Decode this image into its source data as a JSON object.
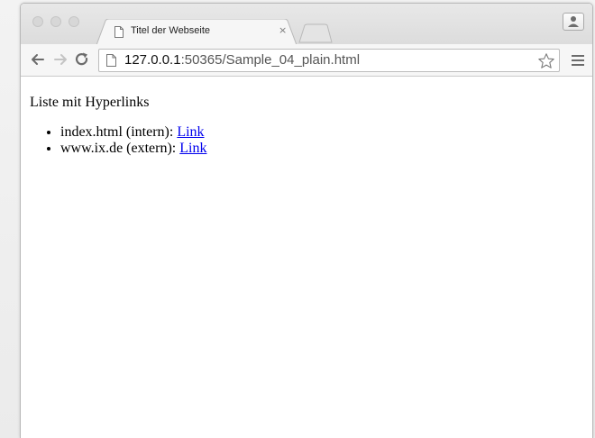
{
  "tab": {
    "title": "Titel der Webseite",
    "close_glyph": "×"
  },
  "toolbar": {
    "back_icon": "back-arrow-icon",
    "forward_icon": "forward-arrow-icon",
    "reload_icon": "reload-icon",
    "url_host": "127.0.0.1",
    "url_rest": ":50365/Sample_04_plain.html",
    "bookmark_icon": "star-icon",
    "menu_icon": "hamburger-menu-icon"
  },
  "page": {
    "heading": "Liste mit Hyperlinks",
    "items": [
      {
        "label": "index.html (intern): ",
        "link_text": "Link"
      },
      {
        "label": "www.ix.de (extern): ",
        "link_text": "Link"
      }
    ]
  },
  "colors": {
    "link": "#0000ee",
    "window_chrome": "#dcdcdc"
  }
}
